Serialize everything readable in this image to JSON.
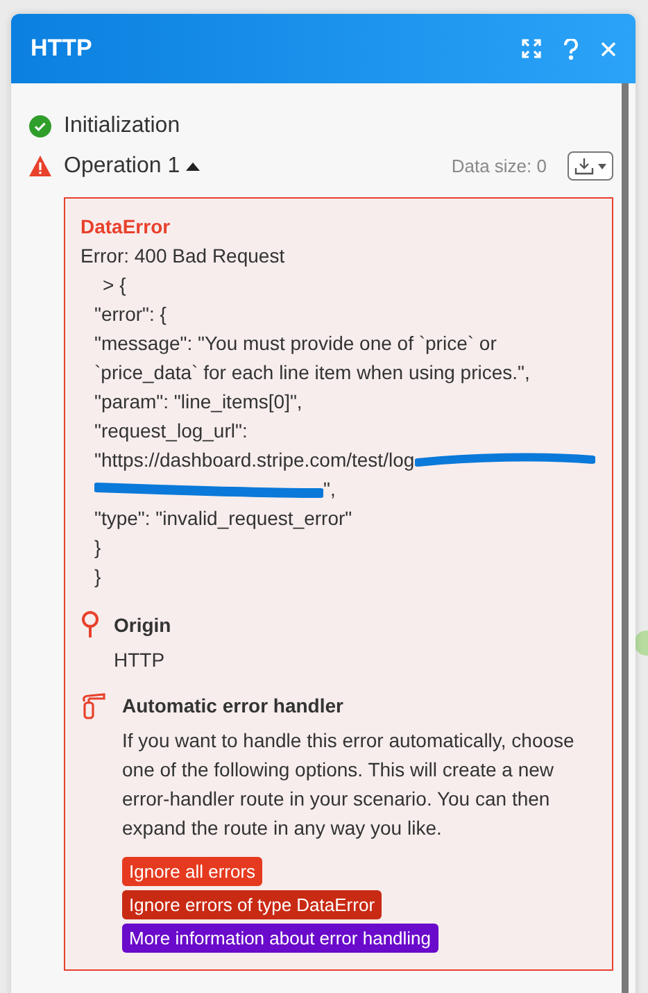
{
  "window": {
    "title": "HTTP"
  },
  "steps": [
    {
      "kind": "success",
      "label": "Initialization"
    },
    {
      "kind": "warning",
      "label": "Operation 1",
      "expanded": true,
      "data_size": "Data size: 0"
    }
  ],
  "error": {
    "title": "DataError",
    "summary": "Error: 400 Bad Request",
    "code_head": "> {",
    "code_lines": [
      "\"error\": {",
      "\"message\": \"You must provide one of `price` or",
      "`price_data` for each line item when using prices.\",",
      "\"param\": \"line_items[0]\",",
      "\"request_log_url\":"
    ],
    "url_start": "\"https://dashboard.stripe.com/test/log",
    "url_end": "\",",
    "code_tail": [
      "\"type\": \"invalid_request_error\"",
      "}",
      "}"
    ],
    "origin": {
      "title": "Origin",
      "value": "HTTP"
    },
    "handler": {
      "title": "Automatic error handler",
      "text": "If you want to handle this error automatically, choose one of the following options. This will create a new error-handler route in your scenario. You can then expand the route in any way you like."
    },
    "buttons": [
      {
        "label": "Ignore all errors",
        "color": "#e53a1f"
      },
      {
        "label": "Ignore errors of type DataError",
        "color": "#c92a14"
      },
      {
        "label": "More information about error handling",
        "color": "#6a0acb"
      }
    ]
  }
}
